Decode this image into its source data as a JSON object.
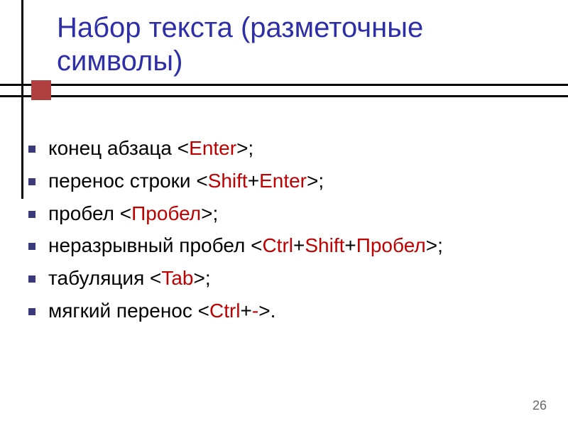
{
  "title": "Набор текста (разметочные символы)",
  "items": [
    {
      "pre": "конец абзаца <",
      "kw": "Enter",
      "post": ">;"
    },
    {
      "pre": "перенос строки <",
      "kw": "Shift",
      "mid": "+",
      "kw2": "Enter",
      "post": ">;"
    },
    {
      "pre": "пробел <",
      "kw": "Пробел",
      "post": ">;"
    },
    {
      "pre": "неразрывный пробел <",
      "kw": "Ctrl",
      "mid": "+",
      "kw2": "Shift",
      "mid2": "+",
      "kw3": "Пробел",
      "post": ">;"
    },
    {
      "pre": "табуляция <",
      "kw": "Tab",
      "post": ">;"
    },
    {
      "pre": "мягкий перенос <",
      "kw": "Ctrl",
      "mid": "+",
      "kw2": "-",
      "post": ">."
    }
  ],
  "page": "26"
}
